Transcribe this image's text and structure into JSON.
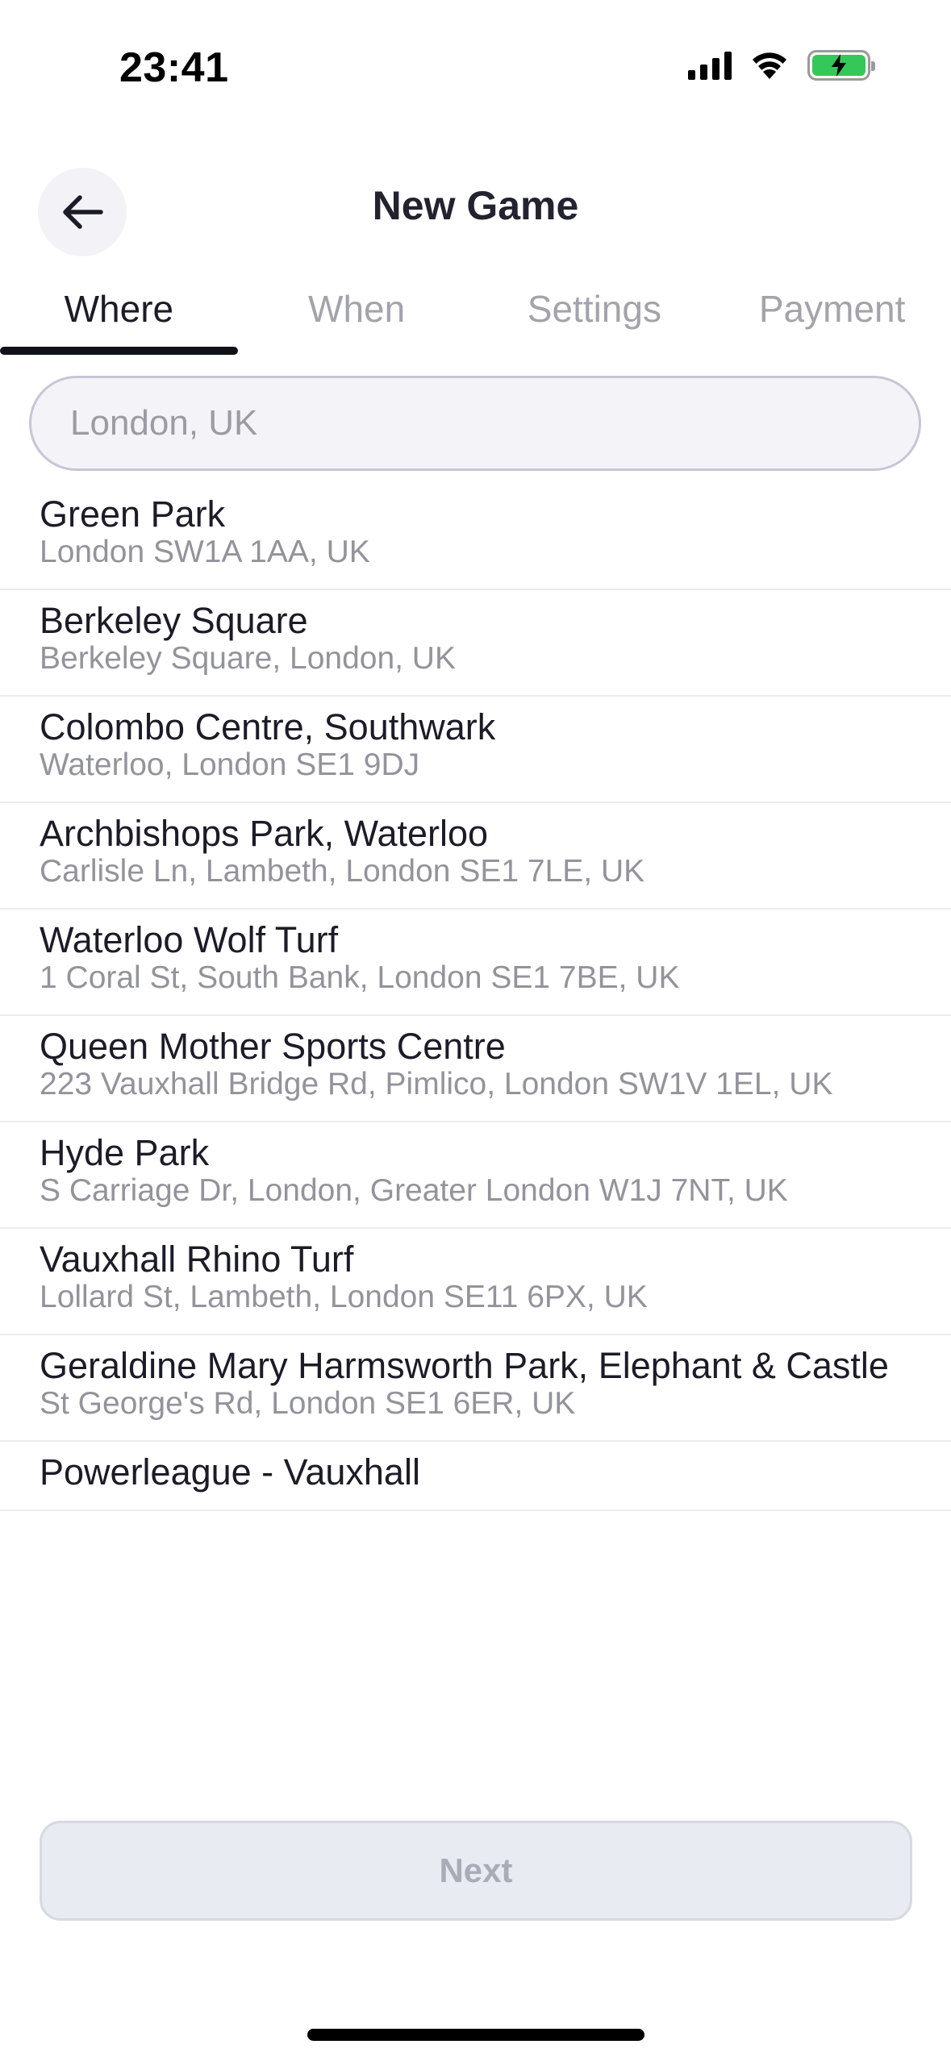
{
  "status_bar": {
    "time": "23:41"
  },
  "header": {
    "title": "New Game",
    "back_icon": "arrow-left-icon"
  },
  "tabs": [
    {
      "label": "Where",
      "active": true
    },
    {
      "label": "When",
      "active": false
    },
    {
      "label": "Settings",
      "active": false
    },
    {
      "label": "Payment",
      "active": false
    }
  ],
  "search": {
    "placeholder": "London, UK",
    "value": ""
  },
  "locations": [
    {
      "name": "Green Park",
      "address": "London SW1A 1AA, UK"
    },
    {
      "name": "Berkeley Square",
      "address": "Berkeley Square, London, UK"
    },
    {
      "name": "Colombo Centre, Southwark",
      "address": "Waterloo, London SE1 9DJ"
    },
    {
      "name": "Archbishops Park, Waterloo",
      "address": "Carlisle Ln, Lambeth, London SE1 7LE, UK"
    },
    {
      "name": "Waterloo Wolf Turf",
      "address": "1 Coral St, South Bank, London SE1 7BE, UK"
    },
    {
      "name": "Queen Mother Sports Centre",
      "address": "223 Vauxhall Bridge Rd, Pimlico, London SW1V 1EL, UK"
    },
    {
      "name": "Hyde Park",
      "address": "S Carriage Dr, London, Greater London W1J 7NT, UK"
    },
    {
      "name": "Vauxhall Rhino Turf",
      "address": "Lollard St, Lambeth, London SE11 6PX, UK"
    },
    {
      "name": "Geraldine Mary Harmsworth Park, Elephant & Castle",
      "address": "St George's Rd, London SE1 6ER, UK"
    },
    {
      "name": "Powerleague - Vauxhall",
      "address": ""
    }
  ],
  "footer": {
    "next_label": "Next",
    "next_enabled": false
  },
  "colors": {
    "active_tab": "#1c1c28",
    "inactive_tab": "#a3a3ab",
    "battery": "#34c759"
  }
}
